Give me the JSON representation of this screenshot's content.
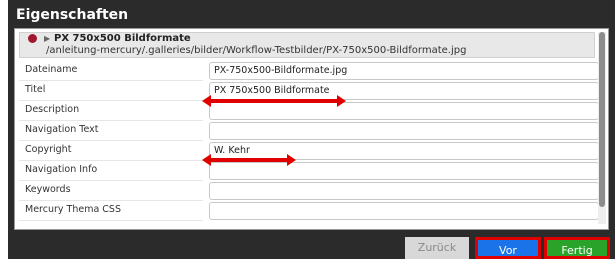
{
  "dialog": {
    "title": "Eigenschaften"
  },
  "resource": {
    "title": "PX 750x500 Bildformate",
    "path": "/anleitung-mercury/.galleries/bilder/Workflow-Testbilder/PX-750x500-Bildformate.jpg",
    "toggle_icon": "triangle-right",
    "status_color": "#a0182e"
  },
  "fields": [
    {
      "label": "Dateiname",
      "value": "PX-750x500-Bildformate.jpg"
    },
    {
      "label": "Titel",
      "value": "PX 750x500 Bildformate"
    },
    {
      "label": "Description",
      "value": ""
    },
    {
      "label": "Navigation Text",
      "value": ""
    },
    {
      "label": "Copyright",
      "value": "W. Kehr"
    },
    {
      "label": "Navigation Info",
      "value": ""
    },
    {
      "label": "Keywords",
      "value": ""
    },
    {
      "label": "Mercury Thema CSS",
      "value": ""
    }
  ],
  "buttons": {
    "back": "Zurück",
    "next": "Vor",
    "done": "Fertig"
  },
  "colors": {
    "accent_blue": "#1a73e8",
    "accent_green": "#2aa32a",
    "annotation_red": "#e00000"
  }
}
